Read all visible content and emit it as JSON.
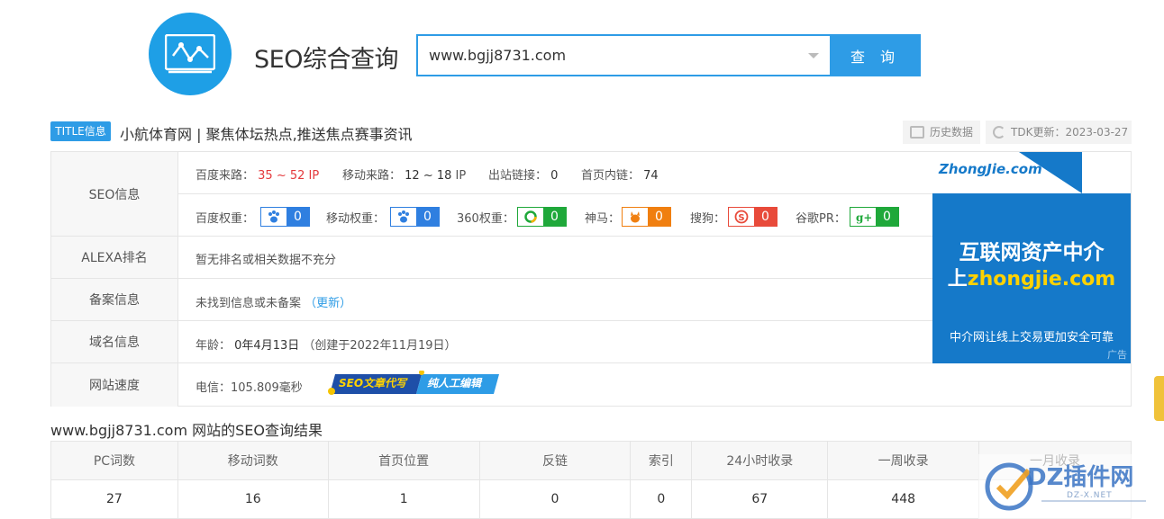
{
  "header": {
    "app_title": "SEO综合查询",
    "search_value": "www.bgjj8731.com",
    "search_button": "查 询"
  },
  "title_row": {
    "tag": "TITLE信息",
    "site_title": "小航体育网 | 聚焦体坛热点,推送焦点赛事资讯",
    "history_button": "历史数据",
    "tdk_update": "TDK更新：2023-03-27"
  },
  "seo_info": {
    "label": "SEO信息",
    "baidu_traffic_label": "百度来路：",
    "baidu_traffic_value": "35 ~ 52",
    "baidu_traffic_unit": "IP",
    "mobile_traffic_label": "移动来路：",
    "mobile_traffic_value": "12 ~ 18",
    "mobile_traffic_unit": "IP",
    "outbound_links_label": "出站链接：",
    "outbound_links_value": "0",
    "home_internal_links_label": "首页内链：",
    "home_internal_links_value": "74",
    "weights": [
      {
        "label": "百度权重：",
        "icon": "baidu-paw-icon",
        "value": "0",
        "color": "#2f7fe0"
      },
      {
        "label": "移动权重：",
        "icon": "baidu-paw-icon",
        "value": "0",
        "color": "#2f7fe0"
      },
      {
        "label": "360权重：",
        "icon": "360-icon",
        "value": "0",
        "color": "#1fa83a"
      },
      {
        "label": "神马：",
        "icon": "shenma-icon",
        "value": "0",
        "color": "#f07f10"
      },
      {
        "label": "搜狗：",
        "icon": "sogou-icon",
        "value": "0",
        "color": "#e84a3a"
      },
      {
        "label": "谷歌PR：",
        "icon": "google-plus-icon",
        "value": "0",
        "color": "#1fa83a"
      }
    ]
  },
  "alexa": {
    "label": "ALEXA排名",
    "value": "暂无排名或相关数据不充分"
  },
  "icp": {
    "label": "备案信息",
    "value": "未找到信息或未备案",
    "update_link": "（更新）"
  },
  "domain": {
    "label": "域名信息",
    "age_label": "年龄：",
    "age_value": "0年4月13日",
    "created": "（创建于2022年11月19日）"
  },
  "speed": {
    "label": "网站速度",
    "value": "电信：105.809毫秒",
    "banner_left": "SEO文章代写",
    "banner_right": "纯人工编辑"
  },
  "ad": {
    "logo": "ZhongJie.com",
    "line1": "互联网资产中介",
    "line2_prefix": "上",
    "line2_domain": "zhongjie.com",
    "line3": "中介网让线上交易更加安全可靠",
    "tag": "广告"
  },
  "results": {
    "title": "www.bgjj8731.com 网站的SEO查询结果",
    "headers": [
      "PC词数",
      "移动词数",
      "首页位置",
      "反链",
      "索引",
      "24小时收录",
      "一周收录",
      "一月收录"
    ],
    "values": [
      "27",
      "16",
      "1",
      "0",
      "0",
      "67",
      "448",
      ""
    ]
  },
  "watermark": {
    "text": "DZ插件网",
    "sub": "DZ-X.NET"
  }
}
